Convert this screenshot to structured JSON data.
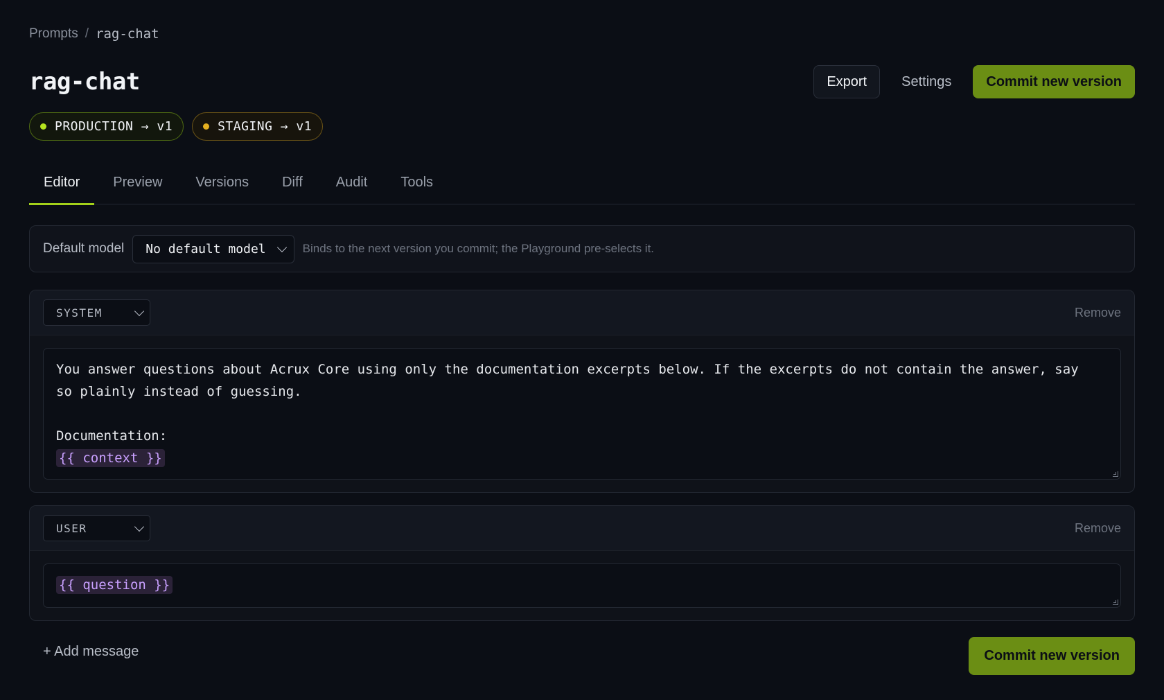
{
  "breadcrumb": {
    "root": "Prompts",
    "separator": "/",
    "current": "rag-chat"
  },
  "title": "rag-chat",
  "header": {
    "export_label": "Export",
    "settings_label": "Settings",
    "commit_label": "Commit new version"
  },
  "environments": [
    {
      "label": "PRODUCTION → v1",
      "status_color": "#b6e51f"
    },
    {
      "label": "STAGING → v1",
      "status_color": "#e5b020"
    }
  ],
  "tabs": [
    {
      "label": "Editor",
      "active": true
    },
    {
      "label": "Preview"
    },
    {
      "label": "Versions"
    },
    {
      "label": "Diff"
    },
    {
      "label": "Audit"
    },
    {
      "label": "Tools"
    }
  ],
  "default_model": {
    "label": "Default model",
    "selected": "No default model",
    "hint": "Binds to the next version you commit; the Playground pre-selects it."
  },
  "messages": [
    {
      "role": "SYSTEM",
      "remove_label": "Remove",
      "text_line1": "You answer questions about Acrux Core using only the documentation excerpts below. If the excerpts do not contain the answer, say",
      "text_line2": "so plainly instead of guessing.",
      "text_line3": "Documentation:",
      "variable": "{{ context }}"
    },
    {
      "role": "USER",
      "remove_label": "Remove",
      "variable": "{{ question }}"
    }
  ],
  "footer": {
    "add_message_label": "+ Add message",
    "commit_label": "Commit new version"
  },
  "colors": {
    "accent": "#a3d11a",
    "primary_button": "#6b8e14",
    "variable_bg": "#2b2238",
    "variable_text": "#c9a0ff"
  }
}
